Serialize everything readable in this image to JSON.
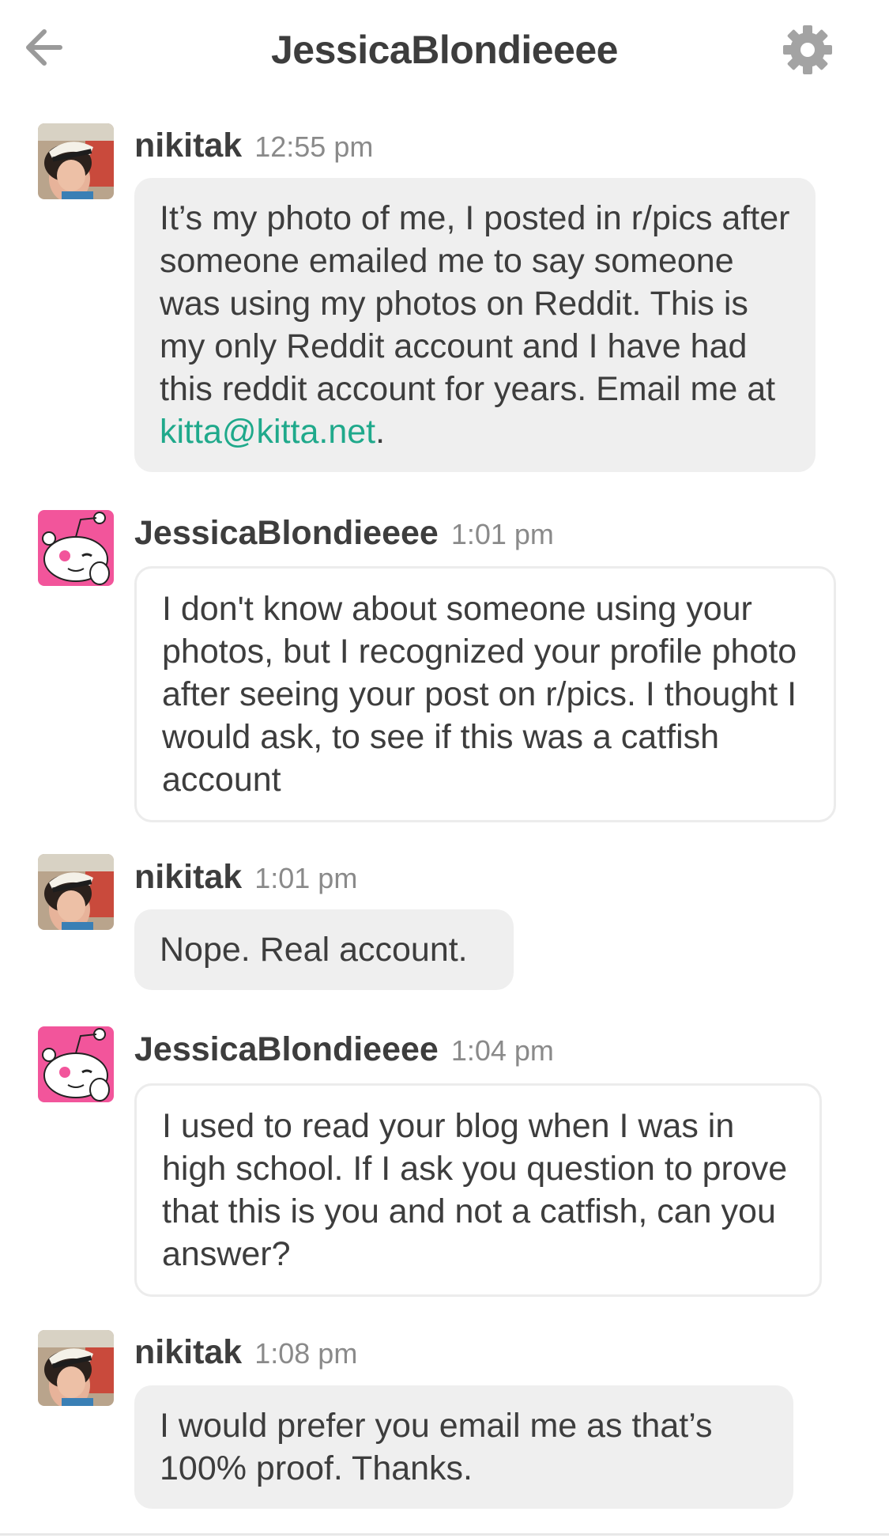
{
  "header": {
    "title": "JessicaBlondieeee",
    "back_icon": "arrow-left-icon",
    "settings_icon": "gear-icon"
  },
  "colors": {
    "link": "#1fa98b",
    "bubble_fill": "#efefef",
    "snoo_pink": "#f2559b"
  },
  "messages": [
    {
      "author": "nikitak",
      "time": "12:55 pm",
      "text_before_link": "It’s my photo of me, I posted in r/pics after someone emailed me to say someone was using my photos on Reddit. This is my only Reddit account and I have had this reddit account for years. Email me at ",
      "link": "kitta@kitta.net",
      "text_after_link": "."
    },
    {
      "author": "JessicaBlondieeee",
      "time": "1:01 pm",
      "text": "I don't know about someone using your photos, but I recognized your profile photo after seeing your post on r/pics. I thought I would ask, to see if this was a catfish account"
    },
    {
      "author": "nikitak",
      "time": "1:01 pm",
      "text": "Nope. Real account."
    },
    {
      "author": "JessicaBlondieeee",
      "time": "1:04 pm",
      "text": "I used to read your blog when I was in high school. If I ask you question to prove that this is you and not a catfish, can you answer?"
    },
    {
      "author": "nikitak",
      "time": "1:08 pm",
      "text": "I would prefer you email me as that’s 100% proof. Thanks."
    }
  ]
}
